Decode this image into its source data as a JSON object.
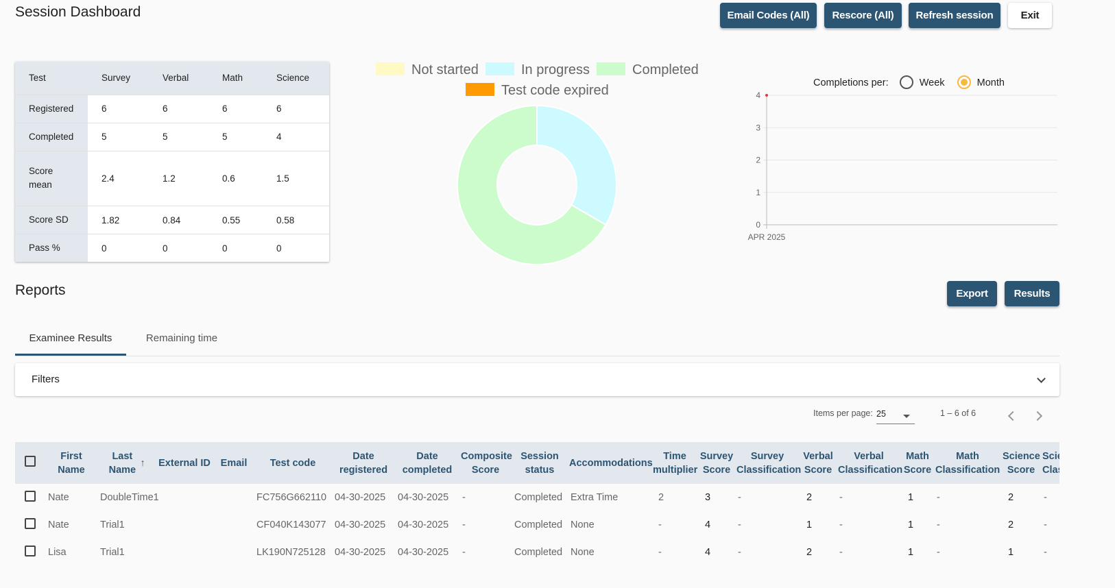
{
  "header": {
    "title": "Session Dashboard",
    "buttons": {
      "email_codes": "Email Codes (All)",
      "rescore": "Rescore (All)",
      "refresh": "Refresh session",
      "exit": "Exit"
    }
  },
  "summary": {
    "columns": [
      "Test",
      "Survey",
      "Verbal",
      "Math",
      "Science"
    ],
    "rows": [
      {
        "label": "Registered",
        "values": [
          "6",
          "6",
          "6",
          "6"
        ]
      },
      {
        "label": "Completed",
        "values": [
          "5",
          "5",
          "5",
          "4"
        ]
      },
      {
        "label": "Score mean",
        "values": [
          "2.4",
          "1.2",
          "0.6",
          "1.5"
        ]
      },
      {
        "label": "Score SD",
        "values": [
          "1.82",
          "0.84",
          "0.55",
          "0.58"
        ]
      },
      {
        "label": "Pass %",
        "values": [
          "0",
          "0",
          "0",
          "0"
        ]
      }
    ]
  },
  "status_chart": {
    "legend": [
      "Not started",
      "In progress",
      "Completed",
      "Test code expired"
    ],
    "colors": {
      "not_started": "#fff9c4",
      "in_progress": "#ccfaff",
      "completed": "#ccfccc",
      "expired": "#ff9a00"
    }
  },
  "completions_chart": {
    "label": "Completions per:",
    "options": [
      "Week",
      "Month"
    ],
    "selected": "Month"
  },
  "chart_data": [
    {
      "type": "pie",
      "legend": [
        "Not started",
        "In progress",
        "Completed",
        "Test code expired"
      ],
      "values": [
        0,
        1,
        2,
        0
      ],
      "donut": true
    },
    {
      "type": "line",
      "categories": [
        "APR 2025"
      ],
      "series": [
        {
          "values": [
            4
          ]
        }
      ],
      "ylim": [
        0,
        4
      ],
      "yticks": [
        "0",
        "1",
        "2",
        "3",
        "4"
      ]
    }
  ],
  "reports": {
    "title": "Reports",
    "export": "Export",
    "results": "Results",
    "tabs": [
      "Examinee Results",
      "Remaining time"
    ],
    "filters": "Filters",
    "items_per_page_label": "Items per page:",
    "items_per_page": "25",
    "range": "1 – 6 of 6"
  },
  "table": {
    "headers": [
      "First Name",
      "Last Name",
      "External ID",
      "Email",
      "Test code",
      "Date registered",
      "Date completed",
      "Composite Score",
      "Session status",
      "Accommodations",
      "Time multiplier",
      "Survey Score",
      "Survey Classification",
      "Verbal Score",
      "Verbal Classification",
      "Math Score",
      "Math Classification",
      "Science Score",
      "Science Classification"
    ],
    "rows": [
      [
        "Nate",
        "DoubleTime1",
        "",
        "",
        "FC756G662110",
        "04-30-2025",
        "04-30-2025",
        "-",
        "Completed",
        "Extra Time",
        "2",
        "3",
        "-",
        "2",
        "-",
        "1",
        "-",
        "2",
        "-"
      ],
      [
        "Nate",
        "Trial1",
        "",
        "",
        "CF040K143077",
        "04-30-2025",
        "04-30-2025",
        "-",
        "Completed",
        "None",
        "-",
        "4",
        "-",
        "1",
        "-",
        "1",
        "-",
        "2",
        "-"
      ],
      [
        "Lisa",
        "Trial1",
        "",
        "",
        "LK190N725128",
        "04-30-2025",
        "04-30-2025",
        "-",
        "Completed",
        "None",
        "-",
        "4",
        "-",
        "2",
        "-",
        "1",
        "-",
        "1",
        "-"
      ]
    ]
  }
}
